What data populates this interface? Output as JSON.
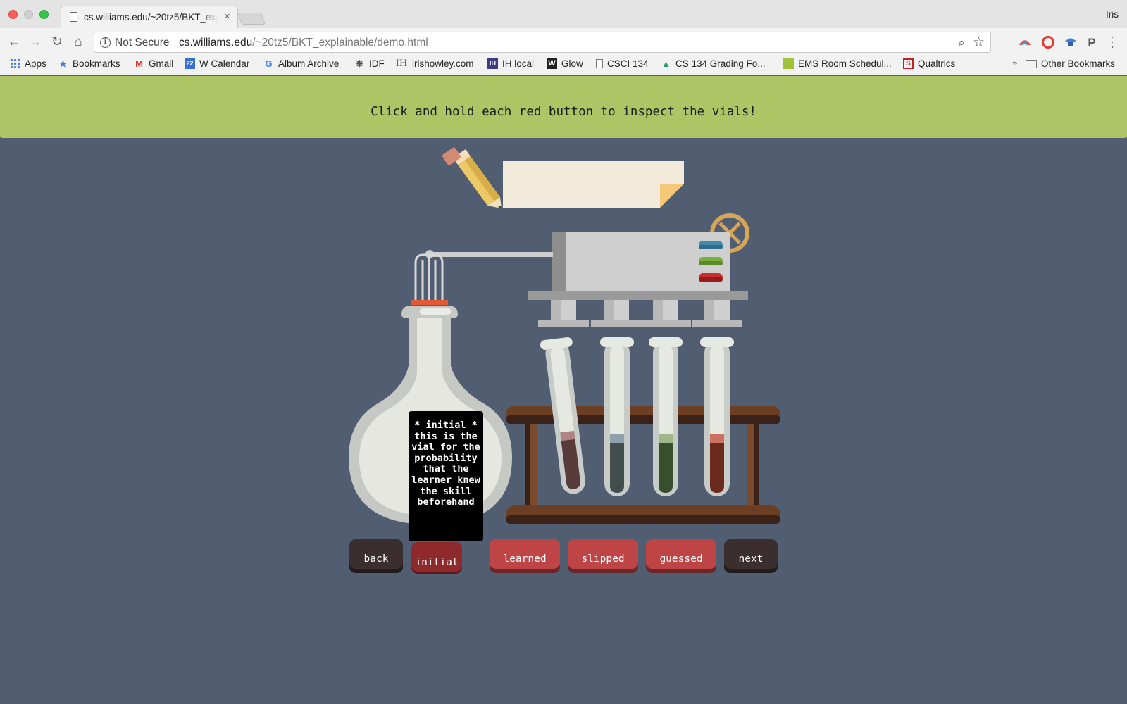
{
  "browser": {
    "tab_title": "cs.williams.edu/~20tz5/BKT_explainable/demo.html",
    "tab_close": "×",
    "profile": "Iris",
    "security_label": "Not Secure",
    "url_host": "cs.williams.edu",
    "url_path": "/~20tz5/BKT_explainable/demo.html",
    "nav_icons": {
      "back": "←",
      "forward": "→",
      "reload": "↻",
      "home": "⌂"
    },
    "bookmarks": [
      {
        "label": "Apps",
        "icon": "apps-grid-icon"
      },
      {
        "label": "Bookmarks",
        "icon": "star-icon"
      },
      {
        "label": "Gmail",
        "icon": "gmail-icon"
      },
      {
        "label": "W Calendar",
        "icon": "calendar-icon"
      },
      {
        "label": "Album Archive",
        "icon": "google-icon"
      },
      {
        "label": "IDF",
        "icon": "tree-icon"
      },
      {
        "label": "irishowley.com",
        "icon": "ih-icon"
      },
      {
        "label": "IH local",
        "icon": "ih-box-icon"
      },
      {
        "label": "Glow",
        "icon": "w-box-icon"
      },
      {
        "label": "CSCI 134",
        "icon": "page-icon"
      },
      {
        "label": "CS 134 Grading Fo...",
        "icon": "drive-icon"
      },
      {
        "label": "EMS Room Schedul...",
        "icon": "ems-icon"
      },
      {
        "label": "Qualtrics",
        "icon": "qualtrics-icon"
      }
    ],
    "other_bookmarks": "Other Bookmarks",
    "overflow": "»"
  },
  "banner": {
    "text": "Click and hold each red button to inspect the vials!",
    "color": "#adc565"
  },
  "tooltip": {
    "text": "* initial * this is the vial for the probability that the learner knew the skill beforehand"
  },
  "controls": {
    "back": "back",
    "initial": "initial",
    "learned": "learned",
    "slipped": "slipped",
    "guessed": "guessed",
    "next": "next"
  },
  "colors": {
    "background": "#515e72",
    "button_red": "#be4446",
    "button_dark": "#3a2e2f",
    "button_pressed": "#8e2a2c"
  }
}
